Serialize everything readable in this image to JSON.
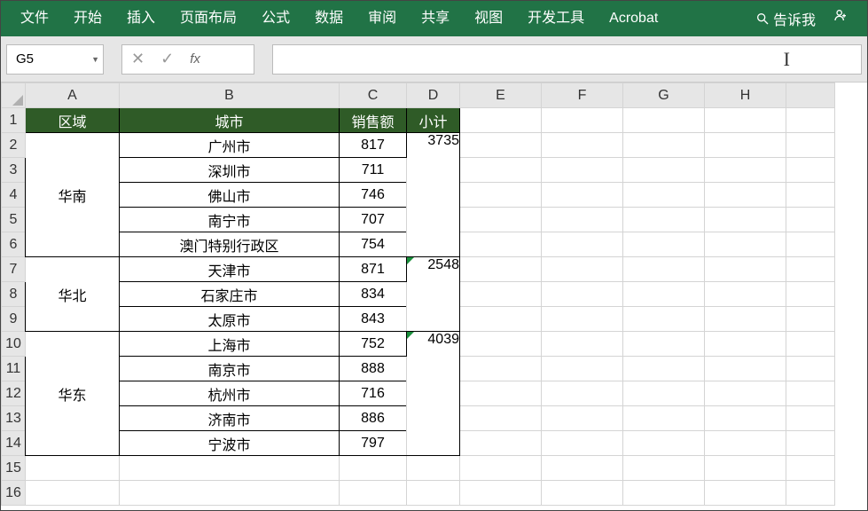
{
  "ribbon": {
    "tabs": [
      "文件",
      "开始",
      "插入",
      "页面布局",
      "公式",
      "数据",
      "审阅",
      "共享",
      "视图",
      "开发工具",
      "Acrobat"
    ],
    "search_placeholder": "告诉我"
  },
  "formula_bar": {
    "name_box": "G5",
    "cancel": "✕",
    "accept": "✓",
    "fx": "fx",
    "formula": ""
  },
  "columns": [
    "A",
    "B",
    "C",
    "D",
    "E",
    "F",
    "G",
    "H",
    ""
  ],
  "rows": [
    "1",
    "2",
    "3",
    "4",
    "5",
    "6",
    "7",
    "8",
    "9",
    "10",
    "11",
    "12",
    "13",
    "14",
    "15",
    "16"
  ],
  "headers": {
    "A": "区域",
    "B": "城市",
    "C": "销售额",
    "D": "小计"
  },
  "groups": [
    {
      "region": "华南",
      "subtotal": "3735",
      "items": [
        {
          "city": "广州市",
          "sales": "817"
        },
        {
          "city": "深圳市",
          "sales": "711"
        },
        {
          "city": "佛山市",
          "sales": "746"
        },
        {
          "city": "南宁市",
          "sales": "707"
        },
        {
          "city": "澳门特别行政区",
          "sales": "754"
        }
      ]
    },
    {
      "region": "华北",
      "subtotal": "2548",
      "items": [
        {
          "city": "天津市",
          "sales": "871"
        },
        {
          "city": "石家庄市",
          "sales": "834"
        },
        {
          "city": "太原市",
          "sales": "843"
        }
      ]
    },
    {
      "region": "华东",
      "subtotal": "4039",
      "items": [
        {
          "city": "上海市",
          "sales": "752"
        },
        {
          "city": "南京市",
          "sales": "888"
        },
        {
          "city": "杭州市",
          "sales": "716"
        },
        {
          "city": "济南市",
          "sales": "886"
        },
        {
          "city": "宁波市",
          "sales": "797"
        }
      ]
    }
  ]
}
